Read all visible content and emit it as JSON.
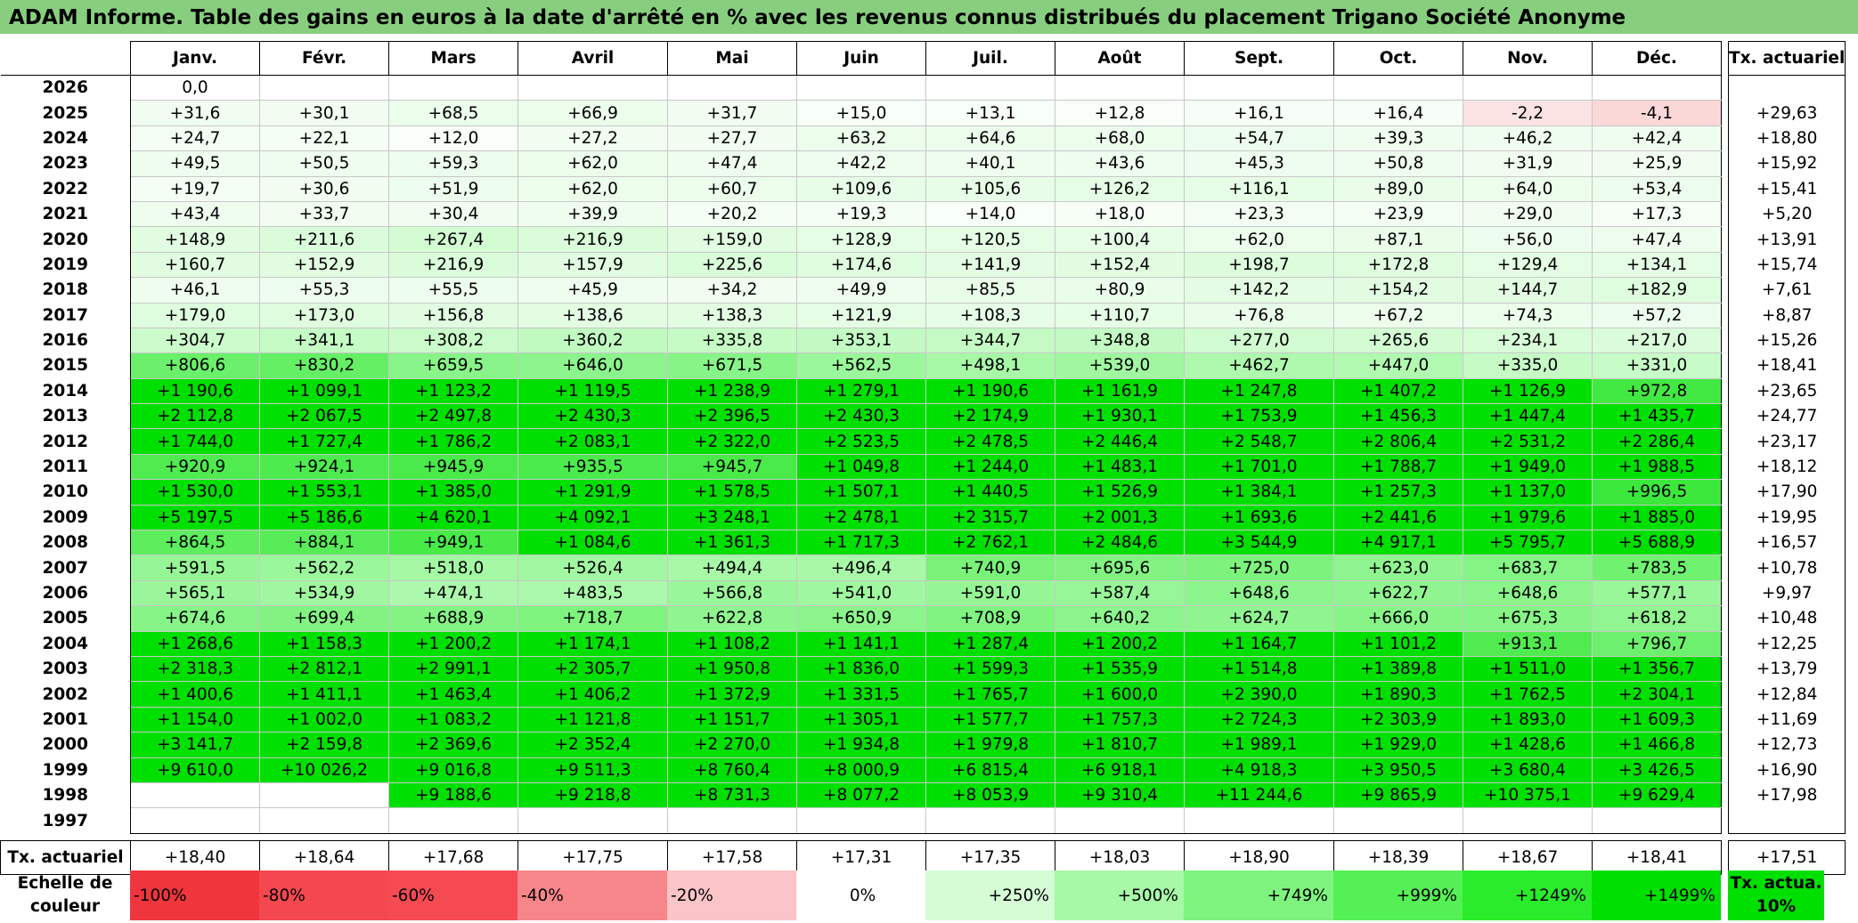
{
  "title": "ADAM Informe. Table des gains en euros à la date d'arrêté en % avec les revenus connus distribués du placement Trigano Société Anonyme",
  "months": [
    "Janv.",
    "Févr.",
    "Mars",
    "Avril",
    "Mai",
    "Juin",
    "Juil.",
    "Août",
    "Sept.",
    "Oct.",
    "Nov.",
    "Déc."
  ],
  "rate_header": "Tx. actuariel",
  "rows": [
    {
      "year": "2026",
      "values": [
        "0,0",
        "",
        "",
        "",
        "",
        "",
        "",
        "",
        "",
        "",
        "",
        ""
      ],
      "rate": ""
    },
    {
      "year": "2025",
      "values": [
        "+31,6",
        "+30,1",
        "+68,5",
        "+66,9",
        "+31,7",
        "+15,0",
        "+13,1",
        "+12,8",
        "+16,1",
        "+16,4",
        "-2,2",
        "-4,1"
      ],
      "rate": "+29,63"
    },
    {
      "year": "2024",
      "values": [
        "+24,7",
        "+22,1",
        "+12,0",
        "+27,2",
        "+27,7",
        "+63,2",
        "+64,6",
        "+68,0",
        "+54,7",
        "+39,3",
        "+46,2",
        "+42,4"
      ],
      "rate": "+18,80"
    },
    {
      "year": "2023",
      "values": [
        "+49,5",
        "+50,5",
        "+59,3",
        "+62,0",
        "+47,4",
        "+42,2",
        "+40,1",
        "+43,6",
        "+45,3",
        "+50,8",
        "+31,9",
        "+25,9"
      ],
      "rate": "+15,92"
    },
    {
      "year": "2022",
      "values": [
        "+19,7",
        "+30,6",
        "+51,9",
        "+62,0",
        "+60,7",
        "+109,6",
        "+105,6",
        "+126,2",
        "+116,1",
        "+89,0",
        "+64,0",
        "+53,4"
      ],
      "rate": "+15,41"
    },
    {
      "year": "2021",
      "values": [
        "+43,4",
        "+33,7",
        "+30,4",
        "+39,9",
        "+20,2",
        "+19,3",
        "+14,0",
        "+18,0",
        "+23,3",
        "+23,9",
        "+29,0",
        "+17,3"
      ],
      "rate": "+5,20"
    },
    {
      "year": "2020",
      "values": [
        "+148,9",
        "+211,6",
        "+267,4",
        "+216,9",
        "+159,0",
        "+128,9",
        "+120,5",
        "+100,4",
        "+62,0",
        "+87,1",
        "+56,0",
        "+47,4"
      ],
      "rate": "+13,91"
    },
    {
      "year": "2019",
      "values": [
        "+160,7",
        "+152,9",
        "+216,9",
        "+157,9",
        "+225,6",
        "+174,6",
        "+141,9",
        "+152,4",
        "+198,7",
        "+172,8",
        "+129,4",
        "+134,1"
      ],
      "rate": "+15,74"
    },
    {
      "year": "2018",
      "values": [
        "+46,1",
        "+55,3",
        "+55,5",
        "+45,9",
        "+34,2",
        "+49,9",
        "+85,5",
        "+80,9",
        "+142,2",
        "+154,2",
        "+144,7",
        "+182,9"
      ],
      "rate": "+7,61"
    },
    {
      "year": "2017",
      "values": [
        "+179,0",
        "+173,0",
        "+156,8",
        "+138,6",
        "+138,3",
        "+121,9",
        "+108,3",
        "+110,7",
        "+76,8",
        "+67,2",
        "+74,3",
        "+57,2"
      ],
      "rate": "+8,87"
    },
    {
      "year": "2016",
      "values": [
        "+304,7",
        "+341,1",
        "+308,2",
        "+360,2",
        "+335,8",
        "+353,1",
        "+344,7",
        "+348,8",
        "+277,0",
        "+265,6",
        "+234,1",
        "+217,0"
      ],
      "rate": "+15,26"
    },
    {
      "year": "2015",
      "values": [
        "+806,6",
        "+830,2",
        "+659,5",
        "+646,0",
        "+671,5",
        "+562,5",
        "+498,1",
        "+539,0",
        "+462,7",
        "+447,0",
        "+335,0",
        "+331,0"
      ],
      "rate": "+18,41"
    },
    {
      "year": "2014",
      "values": [
        "+1 190,6",
        "+1 099,1",
        "+1 123,2",
        "+1 119,5",
        "+1 238,9",
        "+1 279,1",
        "+1 190,6",
        "+1 161,9",
        "+1 247,8",
        "+1 407,2",
        "+1 126,9",
        "+972,8"
      ],
      "rate": "+23,65"
    },
    {
      "year": "2013",
      "values": [
        "+2 112,8",
        "+2 067,5",
        "+2 497,8",
        "+2 430,3",
        "+2 396,5",
        "+2 430,3",
        "+2 174,9",
        "+1 930,1",
        "+1 753,9",
        "+1 456,3",
        "+1 447,4",
        "+1 435,7"
      ],
      "rate": "+24,77"
    },
    {
      "year": "2012",
      "values": [
        "+1 744,0",
        "+1 727,4",
        "+1 786,2",
        "+2 083,1",
        "+2 322,0",
        "+2 523,5",
        "+2 478,5",
        "+2 446,4",
        "+2 548,7",
        "+2 806,4",
        "+2 531,2",
        "+2 286,4"
      ],
      "rate": "+23,17"
    },
    {
      "year": "2011",
      "values": [
        "+920,9",
        "+924,1",
        "+945,9",
        "+935,5",
        "+945,7",
        "+1 049,8",
        "+1 244,0",
        "+1 483,1",
        "+1 701,0",
        "+1 788,7",
        "+1 949,0",
        "+1 988,5"
      ],
      "rate": "+18,12"
    },
    {
      "year": "2010",
      "values": [
        "+1 530,0",
        "+1 553,1",
        "+1 385,0",
        "+1 291,9",
        "+1 578,5",
        "+1 507,1",
        "+1 440,5",
        "+1 526,9",
        "+1 384,1",
        "+1 257,3",
        "+1 137,0",
        "+996,5"
      ],
      "rate": "+17,90"
    },
    {
      "year": "2009",
      "values": [
        "+5 197,5",
        "+5 186,6",
        "+4 620,1",
        "+4 092,1",
        "+3 248,1",
        "+2 478,1",
        "+2 315,7",
        "+2 001,3",
        "+1 693,6",
        "+2 441,6",
        "+1 979,6",
        "+1 885,0"
      ],
      "rate": "+19,95"
    },
    {
      "year": "2008",
      "values": [
        "+864,5",
        "+884,1",
        "+949,1",
        "+1 084,6",
        "+1 361,3",
        "+1 717,3",
        "+2 762,1",
        "+2 484,6",
        "+3 544,9",
        "+4 917,1",
        "+5 795,7",
        "+5 688,9"
      ],
      "rate": "+16,57"
    },
    {
      "year": "2007",
      "values": [
        "+591,5",
        "+562,2",
        "+518,0",
        "+526,4",
        "+494,4",
        "+496,4",
        "+740,9",
        "+695,6",
        "+725,0",
        "+623,0",
        "+683,7",
        "+783,5"
      ],
      "rate": "+10,78"
    },
    {
      "year": "2006",
      "values": [
        "+565,1",
        "+534,9",
        "+474,1",
        "+483,5",
        "+566,8",
        "+541,0",
        "+591,0",
        "+587,4",
        "+648,6",
        "+622,7",
        "+648,6",
        "+577,1"
      ],
      "rate": "+9,97"
    },
    {
      "year": "2005",
      "values": [
        "+674,6",
        "+699,4",
        "+688,9",
        "+718,7",
        "+622,8",
        "+650,9",
        "+708,9",
        "+640,2",
        "+624,7",
        "+666,0",
        "+675,3",
        "+618,2"
      ],
      "rate": "+10,48"
    },
    {
      "year": "2004",
      "values": [
        "+1 268,6",
        "+1 158,3",
        "+1 200,2",
        "+1 174,1",
        "+1 108,2",
        "+1 141,1",
        "+1 287,4",
        "+1 200,2",
        "+1 164,7",
        "+1 101,2",
        "+913,1",
        "+796,7"
      ],
      "rate": "+12,25"
    },
    {
      "year": "2003",
      "values": [
        "+2 318,3",
        "+2 812,1",
        "+2 991,1",
        "+2 305,7",
        "+1 950,8",
        "+1 836,0",
        "+1 599,3",
        "+1 535,9",
        "+1 514,8",
        "+1 389,8",
        "+1 511,0",
        "+1 356,7"
      ],
      "rate": "+13,79"
    },
    {
      "year": "2002",
      "values": [
        "+1 400,6",
        "+1 411,1",
        "+1 463,4",
        "+1 406,2",
        "+1 372,9",
        "+1 331,5",
        "+1 765,7",
        "+1 600,0",
        "+2 390,0",
        "+1 890,3",
        "+1 762,5",
        "+2 304,1"
      ],
      "rate": "+12,84"
    },
    {
      "year": "2001",
      "values": [
        "+1 154,0",
        "+1 002,0",
        "+1 083,2",
        "+1 121,8",
        "+1 151,7",
        "+1 305,1",
        "+1 577,7",
        "+1 757,3",
        "+2 724,3",
        "+2 303,9",
        "+1 893,0",
        "+1 609,3"
      ],
      "rate": "+11,69"
    },
    {
      "year": "2000",
      "values": [
        "+3 141,7",
        "+2 159,8",
        "+2 369,6",
        "+2 352,4",
        "+2 270,0",
        "+1 934,8",
        "+1 979,8",
        "+1 810,7",
        "+1 989,1",
        "+1 929,0",
        "+1 428,6",
        "+1 466,8"
      ],
      "rate": "+12,73"
    },
    {
      "year": "1999",
      "values": [
        "+9 610,0",
        "+10 026,2",
        "+9 016,8",
        "+9 511,3",
        "+8 760,4",
        "+8 000,9",
        "+6 815,4",
        "+6 918,1",
        "+4 918,3",
        "+3 950,5",
        "+3 680,4",
        "+3 426,5"
      ],
      "rate": "+16,90"
    },
    {
      "year": "1998",
      "values": [
        "",
        "",
        "+9 188,6",
        "+9 218,8",
        "+8 731,3",
        "+8 077,2",
        "+8 053,9",
        "+9 310,4",
        "+11 244,6",
        "+9 865,9",
        "+10 375,1",
        "+9 629,4"
      ],
      "rate": "+17,98"
    },
    {
      "year": "1997",
      "values": [
        "",
        "",
        "",
        "",
        "",
        "",
        "",
        "",
        "",
        "",
        "",
        ""
      ],
      "rate": ""
    }
  ],
  "footer": {
    "label": "Tx. actuariel",
    "values": [
      "+18,40",
      "+18,64",
      "+17,68",
      "+17,75",
      "+17,58",
      "+17,31",
      "+17,35",
      "+18,03",
      "+18,90",
      "+18,39",
      "+18,67",
      "+18,41"
    ],
    "rate": "+17,51"
  },
  "legend": {
    "label": "Echelle de couleur",
    "items": [
      {
        "text": "-100%",
        "color": "#f0353d"
      },
      {
        "text": "-80%",
        "color": "#f3484f"
      },
      {
        "text": "-60%",
        "color": "#f54a52"
      },
      {
        "text": "-40%",
        "color": "#f7868b"
      },
      {
        "text": "-20%",
        "color": "#fbc4c6"
      },
      {
        "text": "0%",
        "color": "#ffffff"
      },
      {
        "text": "+250%",
        "color": "#d6fcd6"
      },
      {
        "text": "+500%",
        "color": "#a7f8a7"
      },
      {
        "text": "+749%",
        "color": "#7ef47e"
      },
      {
        "text": "+999%",
        "color": "#55f055"
      },
      {
        "text": "+1249%",
        "color": "#2aec2a"
      },
      {
        "text": "+1499%",
        "color": "#00e000"
      }
    ],
    "rate_label": "Tx. actua. 10%",
    "rate_color": "#00e000"
  },
  "colors": {
    "title_bg": "#87cf7e",
    "neg_light": "#fde8e8",
    "neg_mid": "#fad2d2",
    "pos_max": "#00e000"
  }
}
